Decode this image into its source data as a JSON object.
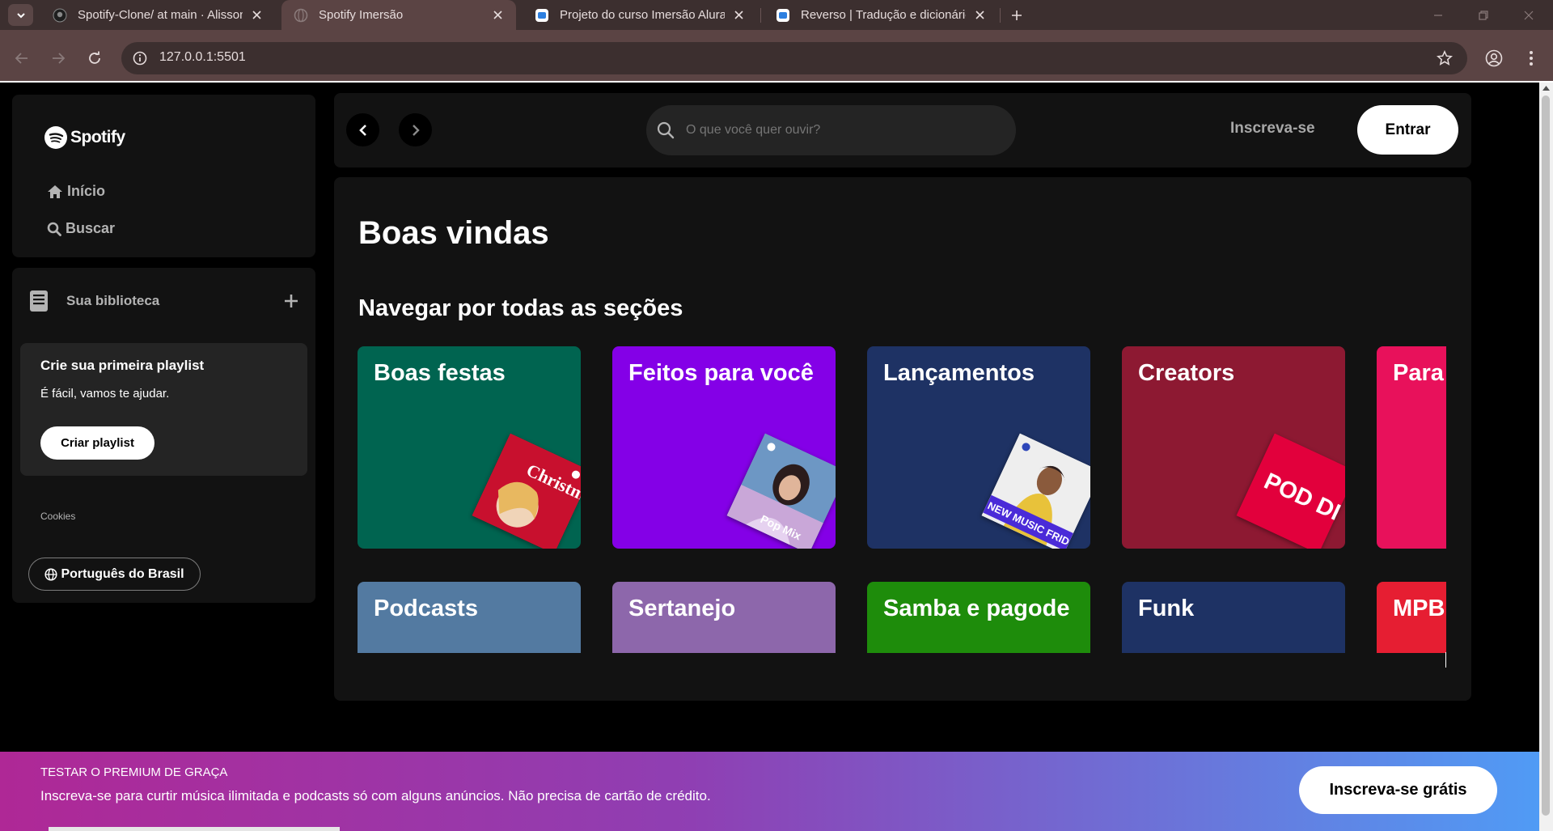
{
  "browser": {
    "tabs": [
      {
        "title": "Spotify-Clone/ at main · Alisson",
        "active": false,
        "favicon": "github-icon"
      },
      {
        "title": "Spotify Imersão",
        "active": true,
        "favicon": "globe-icon"
      },
      {
        "title": "Projeto do curso Imersão Alura",
        "active": false,
        "favicon": "reverso-icon"
      },
      {
        "title": "Reverso | Tradução e dicionário",
        "active": false,
        "favicon": "reverso-icon"
      }
    ],
    "url": "127.0.0.1:5501"
  },
  "sidebar": {
    "logo_text": "Spotify",
    "nav": [
      {
        "label": "Início",
        "icon": "home-icon"
      },
      {
        "label": "Buscar",
        "icon": "search-icon"
      }
    ],
    "library": {
      "title": "Sua biblioteca",
      "playlist_card": {
        "title": "Crie sua primeira playlist",
        "subtitle": "É fácil, vamos te ajudar.",
        "button": "Criar playlist"
      },
      "cookies": "Cookies",
      "language": "Português do Brasil"
    }
  },
  "header": {
    "search_placeholder": "O que você quer ouvir?",
    "signup": "Inscreva-se",
    "login": "Entrar"
  },
  "main": {
    "greeting": "Boas vindas",
    "section_title": "Navegar por todas as seções",
    "cards": [
      {
        "label": "Boas festas",
        "color": "#006450",
        "cover": "christmas-hits"
      },
      {
        "label": "Feitos para você",
        "color": "#8400e7",
        "cover": "pop-mix"
      },
      {
        "label": "Lançamentos",
        "color": "#1e3264",
        "cover": "new-music-friday"
      },
      {
        "label": "Creators",
        "color": "#8d1932",
        "cover": "pod-delas"
      },
      {
        "label": "Para",
        "color": "#e8115b",
        "cover": ""
      },
      {
        "label": "Podcasts",
        "color": "#537aa1",
        "cover": ""
      },
      {
        "label": "Sertanejo",
        "color": "#8d67ab",
        "cover": ""
      },
      {
        "label": "Samba e pagode",
        "color": "#1e8c0b",
        "cover": ""
      },
      {
        "label": "Funk",
        "color": "#1e3264",
        "cover": ""
      },
      {
        "label": "MPB",
        "color": "#e61e32",
        "cover": ""
      }
    ],
    "cover_text": {
      "christmas": "Christmas Hits",
      "popmix": "Pop Mix",
      "nmf": "NEW MUSIC FRIDAY",
      "poddelas": "POD DELAS"
    }
  },
  "banner": {
    "kicker": "TESTAR O PREMIUM DE GRAÇA",
    "text": "Inscreva-se para curtir música ilimitada e podcasts só com alguns anúncios. Não precisa de cartão de crédito.",
    "button": "Inscreva-se grátis"
  }
}
